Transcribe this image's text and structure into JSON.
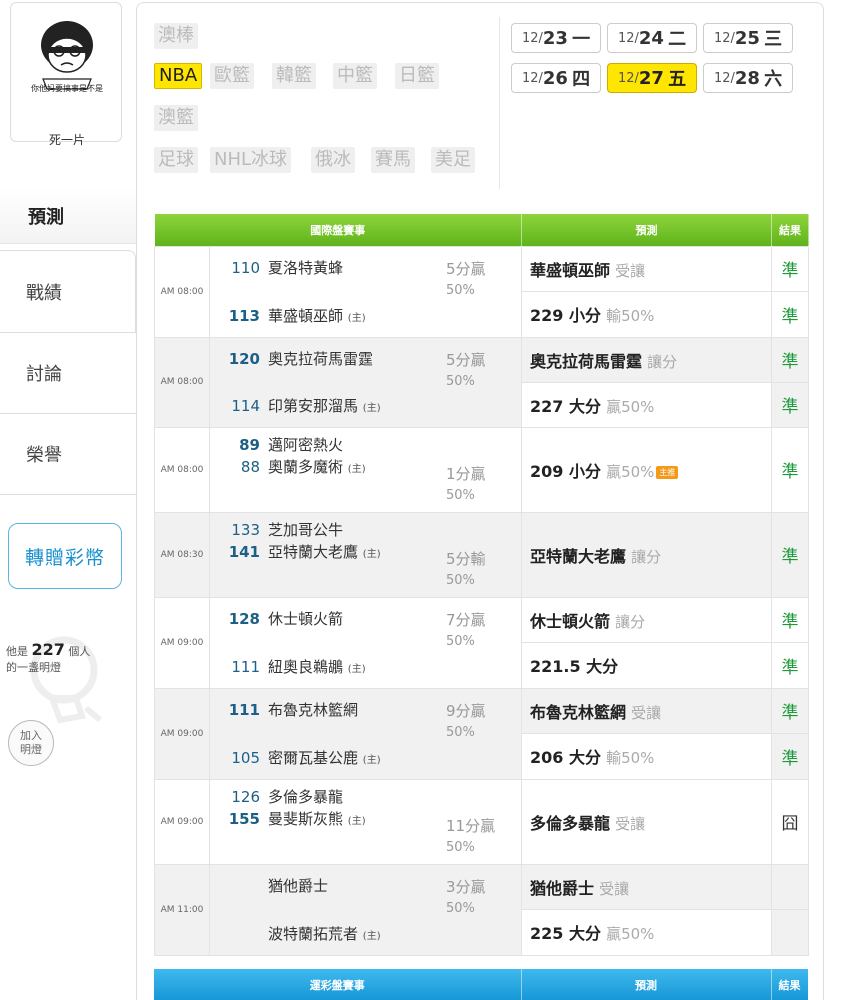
{
  "user": {
    "avatar_caption": "你他妈要搞事是不是",
    "name": "死一片"
  },
  "sidebar": {
    "items": [
      {
        "label": "預測"
      },
      {
        "label": "戰績"
      },
      {
        "label": "討論"
      },
      {
        "label": "榮譽"
      }
    ],
    "gift_label": "轉贈彩幣",
    "fan_prefix": "他是",
    "fan_count": "227",
    "fan_suffix_1": "個人",
    "fan_suffix_2": "的一盞明燈",
    "join_label_1": "加入",
    "join_label_2": "明燈"
  },
  "leagues": [
    {
      "label": "澳棒"
    },
    {
      "label": "NBA",
      "active": true
    },
    {
      "label": "歐籃"
    },
    {
      "label": "韓籃"
    },
    {
      "label": "中籃"
    },
    {
      "label": "日籃"
    },
    {
      "label": "澳籃"
    },
    {
      "label": "足球"
    },
    {
      "label": "NHL冰球"
    },
    {
      "label": "俄冰"
    },
    {
      "label": "賽馬"
    },
    {
      "label": "美足"
    }
  ],
  "dates": [
    {
      "md": "12/",
      "d": "23",
      "wd": "一"
    },
    {
      "md": "12/",
      "d": "24",
      "wd": "二"
    },
    {
      "md": "12/",
      "d": "25",
      "wd": "三"
    },
    {
      "md": "12/",
      "d": "26",
      "wd": "四"
    },
    {
      "md": "12/",
      "d": "27",
      "wd": "五",
      "active": true
    },
    {
      "md": "12/",
      "d": "28",
      "wd": "六"
    }
  ],
  "table1": {
    "headers": [
      "國際盤賽事",
      "預測",
      "結果"
    ],
    "home_mark": "(主)",
    "games": [
      {
        "time": "AM 08:00",
        "t1_no": "110",
        "t1": "夏洛特黃蜂",
        "t2_no": "113",
        "t2": "華盛頓巫師",
        "odds": "5分贏",
        "pct": "50%",
        "p1": "華盛頓巫師",
        "p1s": "受讓",
        "r1": "準",
        "p2": "229 小分",
        "p2s": "輸50%",
        "r2": "準"
      },
      {
        "time": "AM 08:00",
        "t1_no": "120",
        "t1": "奧克拉荷馬雷霆",
        "t2_no": "114",
        "t2": "印第安那溜馬",
        "odds": "5分贏",
        "pct": "50%",
        "p1": "奧克拉荷馬雷霆",
        "p1s": "讓分",
        "r1": "準",
        "p2": "227 大分",
        "p2s": "贏50%",
        "r2": "準"
      },
      {
        "time": "AM 08:00",
        "t1_no": "89",
        "t1": "邁阿密熱火",
        "t2_no": "88",
        "t2": "奧蘭多魔術",
        "odds": "1分贏",
        "pct": "50%",
        "p1": "209 小分",
        "p1s": "贏50%",
        "tag": "主推",
        "r1": "準"
      },
      {
        "time": "AM 08:30",
        "t1_no": "133",
        "t1": "芝加哥公牛",
        "t2_no": "141",
        "t2": "亞特蘭大老鷹",
        "odds": "5分輸",
        "pct": "50%",
        "p1": "亞特蘭大老鷹",
        "p1s": "讓分",
        "r1": "準"
      },
      {
        "time": "AM 09:00",
        "t1_no": "128",
        "t1": "休士頓火箭",
        "t2_no": "111",
        "t2": "紐奧良鵜鶘",
        "odds": "7分贏",
        "pct": "50%",
        "p1": "休士頓火箭",
        "p1s": "讓分",
        "r1": "準",
        "p2": "221.5 大分",
        "p2s": "",
        "r2": "準"
      },
      {
        "time": "AM 09:00",
        "t1_no": "111",
        "t1": "布魯克林籃網",
        "t2_no": "105",
        "t2": "密爾瓦基公鹿",
        "odds": "9分贏",
        "pct": "50%",
        "p1": "布魯克林籃網",
        "p1s": "受讓",
        "r1": "準",
        "p2": "206 大分",
        "p2s": "輸50%",
        "r2": "準"
      },
      {
        "time": "AM 09:00",
        "t1_no": "126",
        "t1": "多倫多暴龍",
        "t2_no": "155",
        "t2": "曼斐斯灰熊",
        "odds": "11分贏",
        "pct": "50%",
        "p1": "多倫多暴龍",
        "p1s": "受讓",
        "r1": "囧"
      },
      {
        "time": "AM 11:00",
        "t1_no": "",
        "t1": "猶他爵士",
        "t2_no": "",
        "t2": "波特蘭拓荒者",
        "odds": "3分贏",
        "pct": "50%",
        "p1": "猶他爵士",
        "p1s": "受讓",
        "r1": "",
        "p2": "225 大分",
        "p2s": "贏50%",
        "r2": ""
      }
    ]
  },
  "table2": {
    "headers": [
      "運彩盤賽事",
      "預測",
      "結果"
    ]
  },
  "colors": {
    "accent_yellow": "#ffe600",
    "header_green": "#6fbf24",
    "header_blue": "#1e9fdd",
    "result_green": "#1c9a3a"
  }
}
